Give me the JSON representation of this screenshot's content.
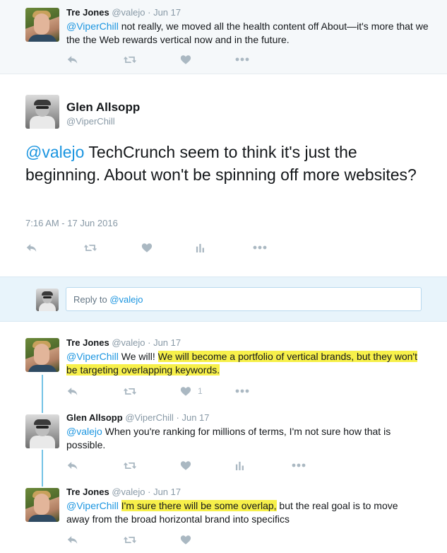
{
  "tweets": {
    "top": {
      "name": "Tre Jones",
      "handle": "@valejo",
      "date": "Jun 17",
      "mention": "@ViperChill",
      "text_rest": " not really, we moved all the health content off About—it's more that we the the Web rewards vertical now and in the future."
    },
    "main": {
      "name": "Glen Allsopp",
      "handle": "@ViperChill",
      "mention": "@valejo",
      "text_rest": " TechCrunch seem to think it's just the beginning. About won't be spinning off more websites?",
      "timestamp": "7:16 AM - 17 Jun 2016"
    },
    "composer": {
      "prefix": "Reply to ",
      "mention": "@valejo"
    },
    "reply1": {
      "name": "Tre Jones",
      "handle": "@valejo",
      "date": "Jun 17",
      "mention": "@ViperChill",
      "text_plain": " We will! ",
      "text_highlight": "We will become a portfolio of vertical brands, but they won't be targeting overlapping keywords.",
      "like_count": "1"
    },
    "reply2": {
      "name": "Glen Allsopp",
      "handle": "@ViperChill",
      "date": "Jun 17",
      "mention": "@valejo",
      "text_rest": " When you're ranking for millions of terms, I'm not sure how that is possible."
    },
    "reply3": {
      "name": "Tre Jones",
      "handle": "@valejo",
      "date": "Jun 17",
      "mention": "@ViperChill",
      "text_highlight": "I'm sure there will be some overlap,",
      "text_rest": " but the real goal is to move away from the broad horizontal brand into specifics"
    }
  },
  "separator": " · ",
  "colors": {
    "link": "#1b95e0",
    "highlight": "#f7f04a",
    "muted": "#8899a6",
    "thread_line": "#74c3e6",
    "composer_bg": "#e8f4fb"
  },
  "icons": [
    "reply-icon",
    "retweet-icon",
    "like-icon",
    "analytics-icon",
    "more-icon"
  ]
}
